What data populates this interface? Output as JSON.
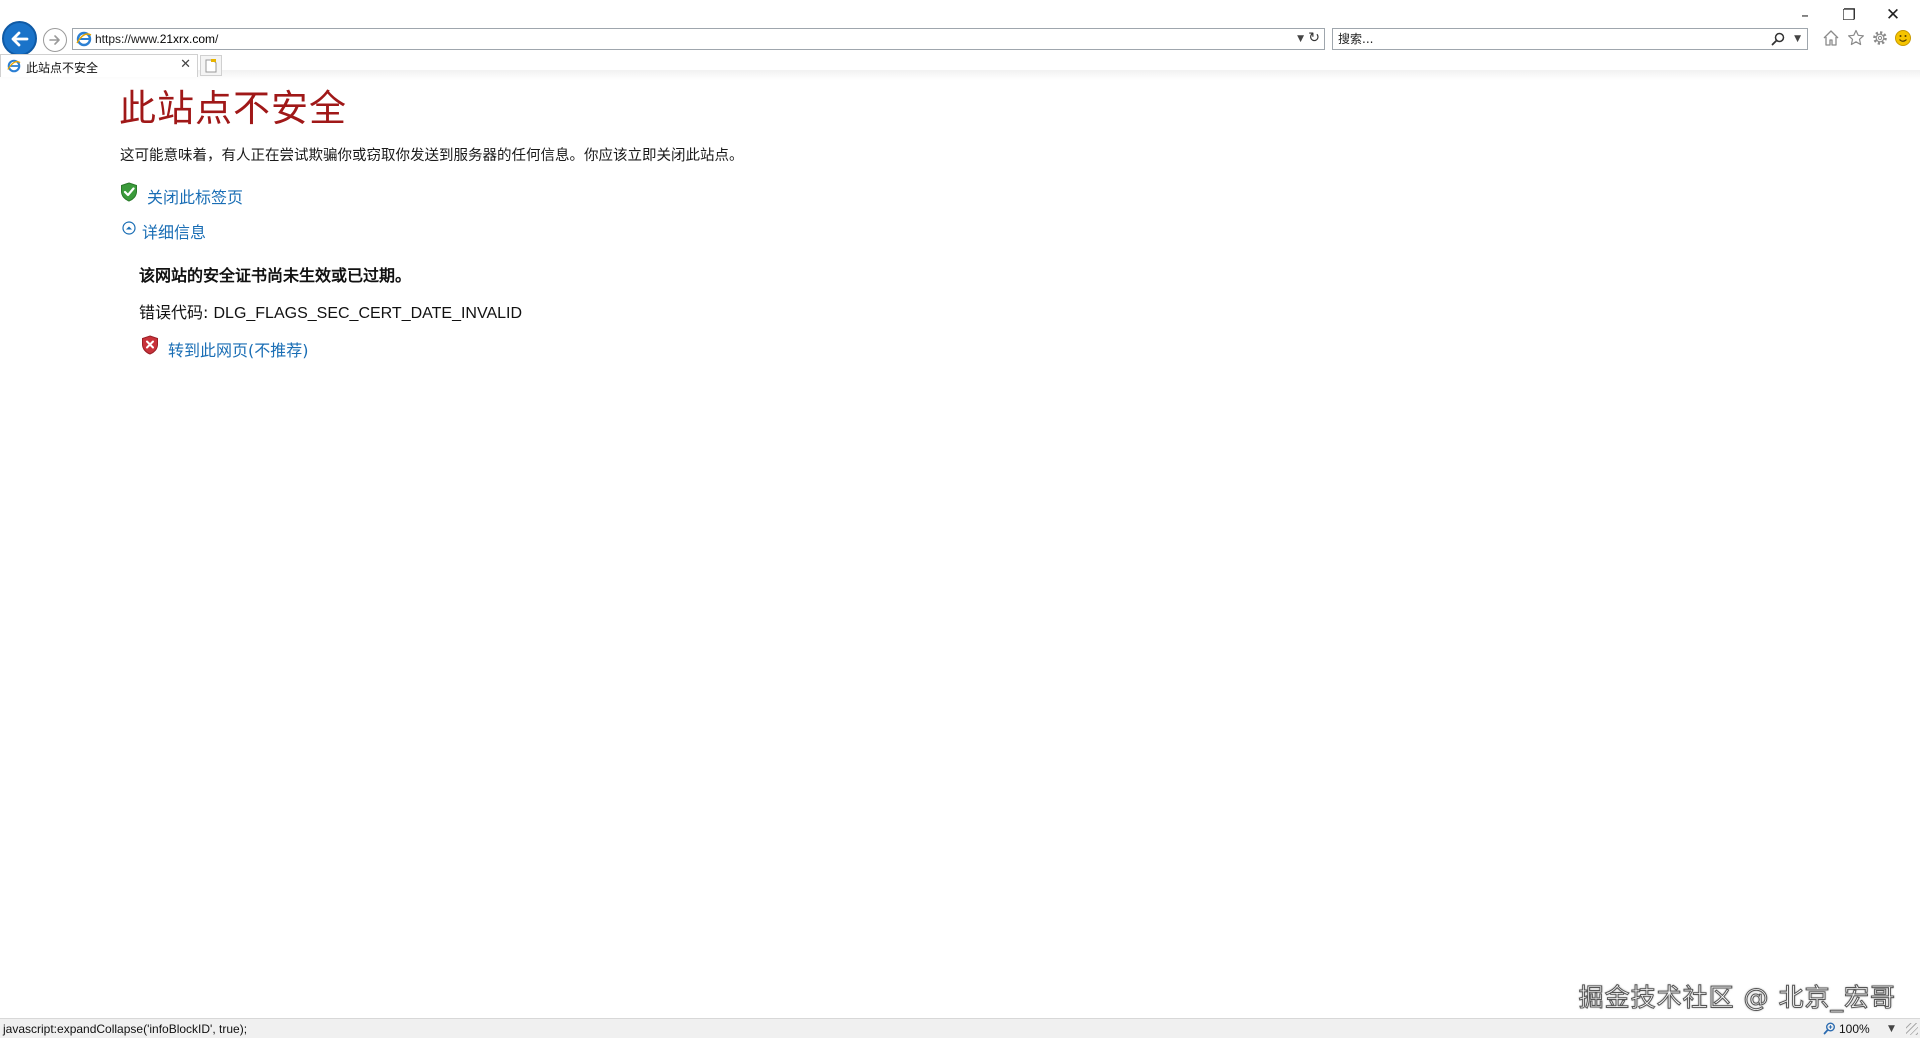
{
  "browser": {
    "address": {
      "scheme": "https://www.",
      "host": "21xrx.com",
      "path": "/"
    },
    "search": {
      "placeholder": "搜索..."
    },
    "tab": {
      "title": "此站点不安全"
    },
    "window_controls": {
      "minimize": "–",
      "restore": "❐",
      "close": "✕"
    },
    "status_text": "javascript:expandCollapse('infoBlockID', true);",
    "zoom": "100%"
  },
  "page": {
    "title": "此站点不安全",
    "warning": "这可能意味着，有人正在尝试欺骗你或窃取你发送到服务器的任何信息。你应该立即关闭此站点。",
    "close_tab_label": "关闭此标签页",
    "details_label": "详细信息",
    "cert_message": "该网站的安全证书尚未生效或已过期。",
    "error_code_prefix": "错误代码: ",
    "error_code": "DLG_FLAGS_SEC_CERT_DATE_INVALID",
    "proceed_label": "转到此网页(不推荐)"
  },
  "watermark": "掘金技术社区 @ 北京_宏哥",
  "colors": {
    "title_red": "#a01818",
    "link_blue": "#1a6eb5",
    "back_button_blue": "#1a73c9",
    "shield_green": "#3b9b3b",
    "shield_red": "#c8323a"
  },
  "icons": [
    "back-arrow-icon",
    "forward-arrow-icon",
    "ie-icon",
    "refresh-icon",
    "search-icon",
    "home-icon",
    "star-icon",
    "gear-icon",
    "smiley-icon",
    "shield-check-icon",
    "collapse-up-icon",
    "shield-x-icon",
    "zoom-icon"
  ]
}
